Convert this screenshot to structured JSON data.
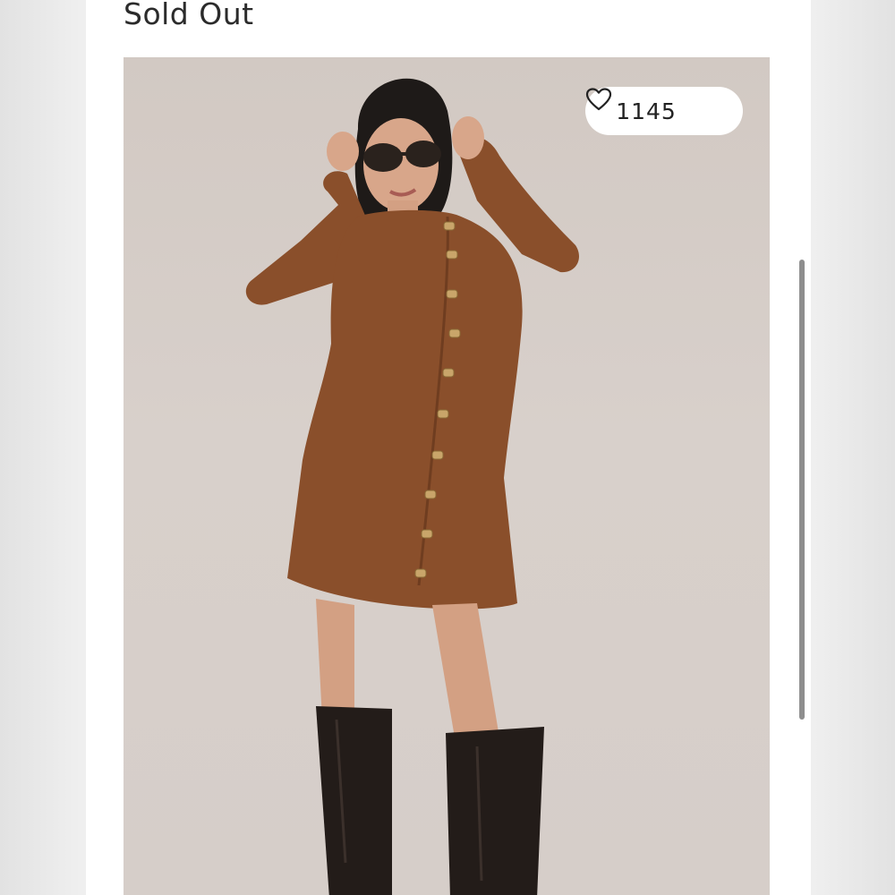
{
  "listing": {
    "status_label": "Sold Out",
    "likes_count": "1145"
  },
  "icons": {
    "like": "heart-icon"
  },
  "colors": {
    "page_bg": "#ffffff",
    "photo_bg": "#d5cdc8",
    "dress": "#8a4f2b",
    "pill_bg": "#ffffff",
    "scrollbar": "#8e8e8e"
  }
}
